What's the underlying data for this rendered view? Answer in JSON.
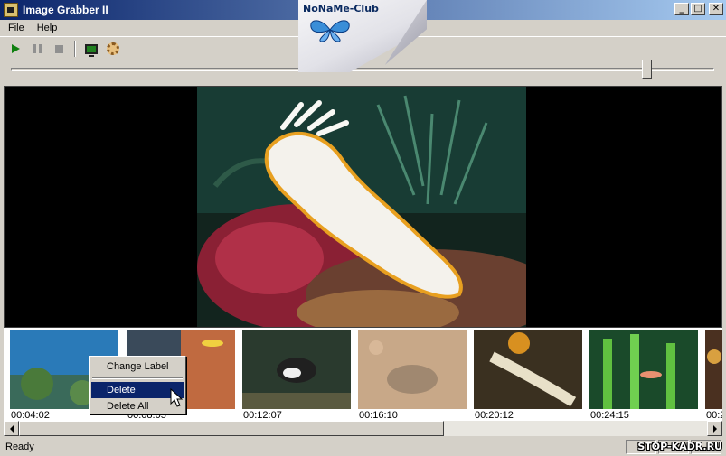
{
  "window": {
    "title": "Image Grabber II"
  },
  "menu": {
    "items": [
      "File",
      "Help"
    ]
  },
  "toolbar": {
    "icons": [
      "play-icon",
      "pause-icon",
      "stop-icon",
      "monitor-icon",
      "gear-icon"
    ]
  },
  "seek": {
    "position": 0.91
  },
  "watermark": {
    "text": "NoNaMe-Club"
  },
  "thumbnails": [
    {
      "time": "00:04:02"
    },
    {
      "time": "00:08:05"
    },
    {
      "time": "00:12:07"
    },
    {
      "time": "00:16:10"
    },
    {
      "time": "00:20:12"
    },
    {
      "time": "00:24:15"
    },
    {
      "time": "00:2"
    }
  ],
  "context_menu": {
    "items": [
      "Change Label",
      "Delete",
      "Delete All"
    ],
    "highlighted": "Delete"
  },
  "status": {
    "text": "Ready",
    "watermark": "STOP-KADR.RU"
  },
  "colors": {
    "title_bar": "#0a246a",
    "selection": "#0a246a",
    "window_bg": "#d4d0c8"
  }
}
